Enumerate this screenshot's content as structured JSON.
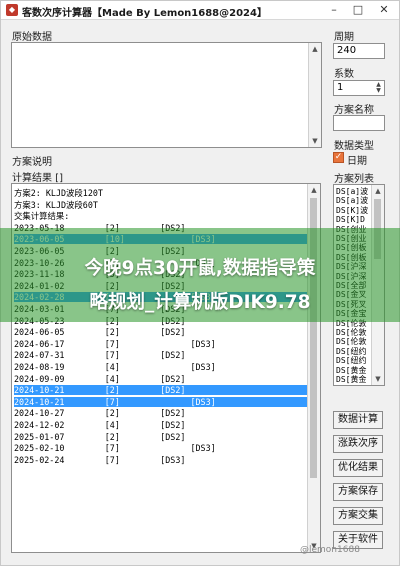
{
  "window": {
    "title": "客数次序计算器【Made By Lemon1688@2024】",
    "app_icon": "app-icon",
    "min_glyph": "–",
    "max_glyph": "□",
    "close_glyph": "✕"
  },
  "left": {
    "raw_label": "原始数据",
    "plan_desc_label": "方案说明",
    "result_label": "计算结果 []"
  },
  "results": [
    {
      "text": "方案2: KLJD波段120T",
      "selected": false
    },
    {
      "text": "方案3: KLJD波段60T",
      "selected": false
    },
    {
      "text": "交集计算结果:",
      "selected": false
    },
    {
      "text": "2023-05-18        [2]        [DS2]",
      "selected": false
    },
    {
      "text": "2023-06-05        [10]             [DS3]",
      "selected": true
    },
    {
      "text": "2023-06-05        [2]        [DS2]",
      "selected": false
    },
    {
      "text": "2023-10-26        [7]              [DS3]",
      "selected": false
    },
    {
      "text": "2023-11-18        [5]        [DS2]",
      "selected": false
    },
    {
      "text": "2024-01-02        [2]        [DS2]",
      "selected": false
    },
    {
      "text": "2024-02-28        [3]              [DS3]",
      "selected": true
    },
    {
      "text": "2024-03-01        [7]        [DS2]",
      "selected": false
    },
    {
      "text": "2024-05-23        [2]        [DS2]",
      "selected": false
    },
    {
      "text": "2024-06-05        [2]        [DS2]",
      "selected": false
    },
    {
      "text": "2024-06-17        [7]              [DS3]",
      "selected": false
    },
    {
      "text": "2024-07-31        [7]        [DS2]",
      "selected": false
    },
    {
      "text": "2024-08-19        [4]              [DS3]",
      "selected": false
    },
    {
      "text": "2024-09-09        [4]        [DS2]",
      "selected": false
    },
    {
      "text": "2024-10-21        [2]        [DS2]",
      "selected": true
    },
    {
      "text": "2024-10-21        [7]              [DS3]",
      "selected": true
    },
    {
      "text": "2024-10-27        [2]        [DS2]",
      "selected": false
    },
    {
      "text": "2024-12-02        [4]        [DS2]",
      "selected": false
    },
    {
      "text": "2025-01-07        [2]        [DS2]",
      "selected": false
    },
    {
      "text": "2025-02-10        [7]              [DS3]",
      "selected": false
    },
    {
      "text": "2025-02-24        [7]        [DS3]",
      "selected": false
    }
  ],
  "right": {
    "period_label": "周期",
    "period_value": "240",
    "param_label": "系数",
    "param_value": "1",
    "plan_name_label": "方案名称",
    "plan_name_value": "",
    "data_type_label": "数据类型",
    "daily_label": "日期",
    "daily_checked": true,
    "plan_list_label": "方案列表",
    "plan_list": [
      "DS[a]波",
      "DS[a]波",
      "DS[K]波",
      "DS[K]D",
      "DS[创业",
      "DS[创业",
      "DS[创板",
      "DS[创板",
      "DS[沪深",
      "DS[沪深",
      "DS[全部",
      "DS[金叉",
      "DS[死叉",
      "DS[金宝",
      "DS[伦敦",
      "DS[伦敦",
      "DS[伦敦",
      "DS[纽约",
      "DS[纽约",
      "DS[黄金",
      "DS[黄金"
    ],
    "buttons": [
      "数据计算",
      "涨跌次序",
      "优化结果",
      "方案保存",
      "方案交集",
      "关于软件"
    ]
  },
  "overlay": {
    "line1": "今晚9点30开鼠,数据指导策",
    "line2": "略规划_计算机版DIK9.78"
  },
  "watermark": "@lemon1688"
}
